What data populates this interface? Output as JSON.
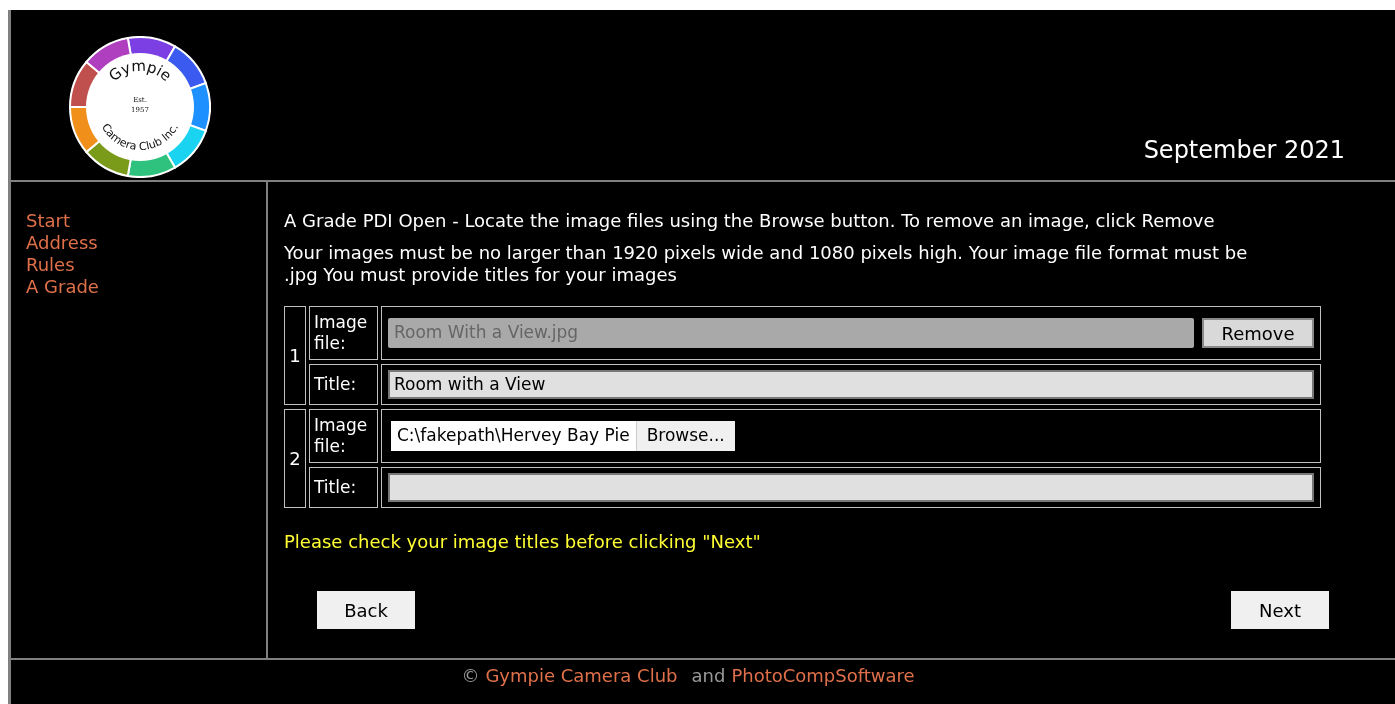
{
  "header": {
    "logo": {
      "top_text": "Gympie",
      "est": "Est.",
      "year": "1957",
      "bottom_text": "Camera Club Inc."
    },
    "date": "September 2021"
  },
  "sidebar": {
    "items": [
      {
        "label": "Start"
      },
      {
        "label": "Address"
      },
      {
        "label": "Rules"
      },
      {
        "label": "A Grade"
      }
    ]
  },
  "intro": "A Grade PDI Open - Locate the image files using the Browse button. To remove an image, click Remove",
  "requirements": "Your images must be no larger than 1920 pixels wide and 1080 pixels high. Your image file format must be .jpg You must provide titles for your images",
  "entries": [
    {
      "number": "1",
      "file_label": "Image file:",
      "file": {
        "kind": "chosen",
        "value": "Room With a View.jpg",
        "button": "Remove"
      },
      "title_label": "Title:",
      "title_value": "Room with a View"
    },
    {
      "number": "2",
      "file_label": "Image file:",
      "file": {
        "kind": "picker",
        "value": "C:\\fakepath\\Hervey Bay Pie",
        "button": "Browse..."
      },
      "title_label": "Title:"
    }
  ],
  "notice": "Please check your image titles before clicking \"Next\"",
  "buttons": {
    "back": "Back",
    "next": "Next"
  },
  "footer": {
    "symbol": "©",
    "club_link": "Gympie Camera Club",
    "joiner": "and",
    "software_link": "PhotoCompSoftware"
  }
}
